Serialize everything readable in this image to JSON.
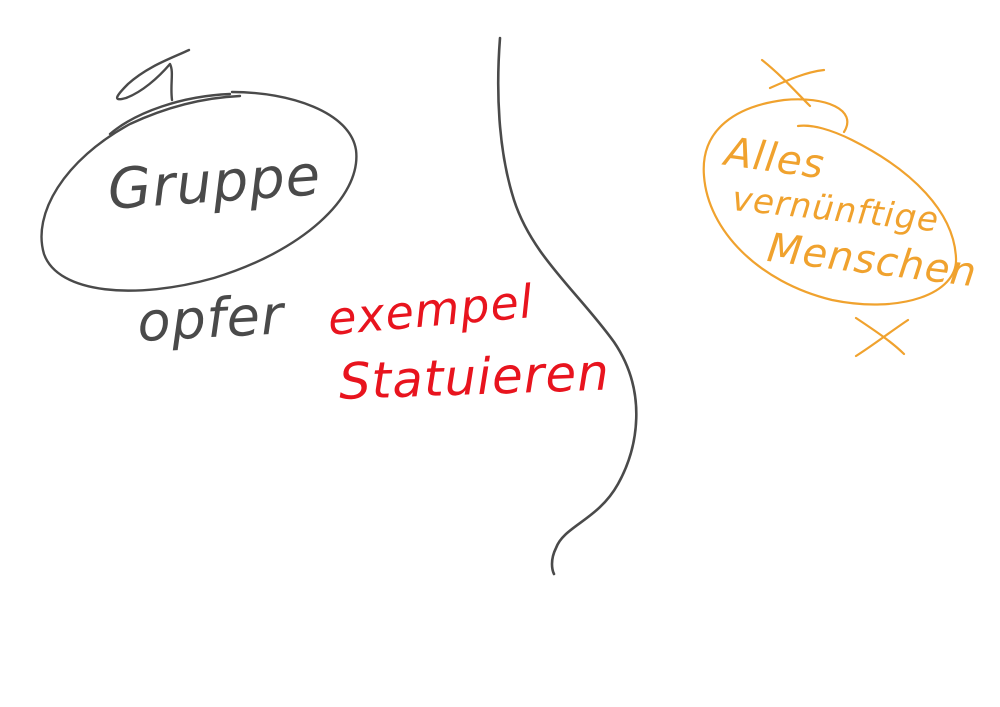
{
  "colors": {
    "background": "#ffffff",
    "dark_ink": "#4a4a4a",
    "red_ink": "#e8141e",
    "orange_ink": "#f0a22e"
  },
  "notes": {
    "left": {
      "word_1": "Gruppe",
      "word_2": "opfer",
      "ink": "dark"
    },
    "middle": {
      "word_1": "exempel",
      "word_2": "Statuieren",
      "ink": "red"
    },
    "right": {
      "word_1": "Alles",
      "word_2": "vernünftige",
      "word_3": "Menschen",
      "ink": "orange"
    }
  }
}
